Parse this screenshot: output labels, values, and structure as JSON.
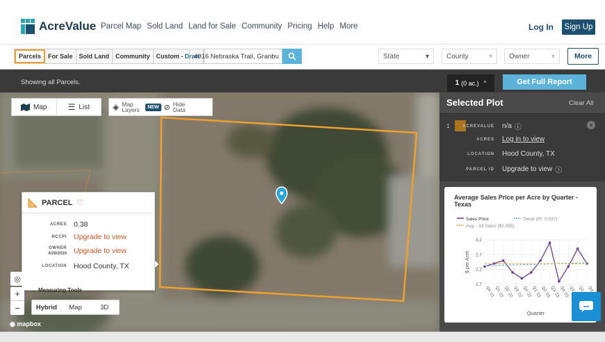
{
  "header": {
    "logo": "AcreValue",
    "nav": [
      "Parcel Map",
      "Sold Land",
      "Land for Sale",
      "Community",
      "Pricing",
      "Help",
      "More"
    ],
    "login": "Log In",
    "signup": "Sign Up"
  },
  "filterbar": {
    "tabs": [
      {
        "label": "Parcels",
        "active": true
      },
      {
        "label": "For Sale",
        "active": false
      },
      {
        "label": "Sold Land",
        "active": false
      },
      {
        "label": "Community",
        "active": false
      },
      {
        "label": "Custom -",
        "suffix": "Draw",
        "active": false
      }
    ],
    "search_value": "4016 Nebraska Trail, Granbu",
    "state": "State",
    "county": "County",
    "owner": "Owner",
    "more": "More"
  },
  "statusbar": {
    "showing": "Showing all Parcels.",
    "count": "1",
    "count_sub": "(0 ac.)",
    "report": "Get Full Report"
  },
  "map": {
    "view_map": "Map",
    "view_list": "List",
    "layers": "Map Layers",
    "new_badge": "NEW",
    "hide_data": "Hide Data",
    "measuring_tools": "Measuring Tools",
    "map_types": [
      "Hybrid",
      "Map",
      "3D"
    ],
    "mapbox": "mapbox",
    "parcel": {
      "title": "PARCEL",
      "acres_label": "ACRES",
      "acres": "0.38",
      "nccpi_label": "NCCPI",
      "nccpi": "Upgrade to view",
      "owner_label": "OWNER",
      "owner_date": "4/26/2024",
      "owner": "Upgrade to view",
      "location_label": "LOCATION",
      "location": "Hood County, TX"
    },
    "accent": "#f0a030"
  },
  "panel": {
    "title": "Selected Plot",
    "clear_all": "Clear All",
    "index": "1",
    "acrevalue_label": "ACREVALUE",
    "acrevalue": "n/a",
    "acres_label": "ACRES",
    "acres": "Log in to view",
    "location_label": "LOCATION",
    "location": "Hood County, TX",
    "parcel_id_label": "PARCEL ID",
    "parcel_id": "Upgrade to view",
    "chart_title": "Average Sales Price per Acre by Quarter - Texas"
  },
  "chart_data": {
    "type": "line",
    "title": "Average Sales Price per Acre by Quarter - Texas",
    "xlabel": "Quarter",
    "ylabel": "$ per Acre",
    "ylim": [
      1.7,
      3.2
    ],
    "yticks": [
      "1.7",
      "2.2",
      "2.7",
      "3.2"
    ],
    "categories": [
      "Q4 '21",
      "Q1 '22",
      "Q2 '22",
      "Q3 '22",
      "Q4 '22",
      "Q1 '23",
      "Q2 '23",
      "Q3 '23",
      "Q4 '23",
      "Q1 '24",
      "Q2 '24",
      "Q3 '24"
    ],
    "series": [
      {
        "name": "Sales Price",
        "values": [
          2.3,
          2.4,
          2.5,
          2.1,
          1.9,
          2.1,
          2.5,
          3.1,
          1.8,
          2.3,
          2.9,
          2.4
        ]
      },
      {
        "name": "Trend (R²: 0.037)",
        "values": [
          2.32,
          2.33,
          2.34,
          2.35,
          2.36,
          2.37,
          2.38,
          2.39,
          2.4,
          2.41,
          2.42,
          2.43
        ]
      },
      {
        "name": "Avg. - All Sales ($2,395)",
        "values": [
          2.395,
          2.395,
          2.395,
          2.395,
          2.395,
          2.395,
          2.395,
          2.395,
          2.395,
          2.395,
          2.395,
          2.395
        ]
      }
    ],
    "colors": [
      "#6a3d8f",
      "#5bb3d9",
      "#f0a030"
    ],
    "legend": "top-left"
  }
}
